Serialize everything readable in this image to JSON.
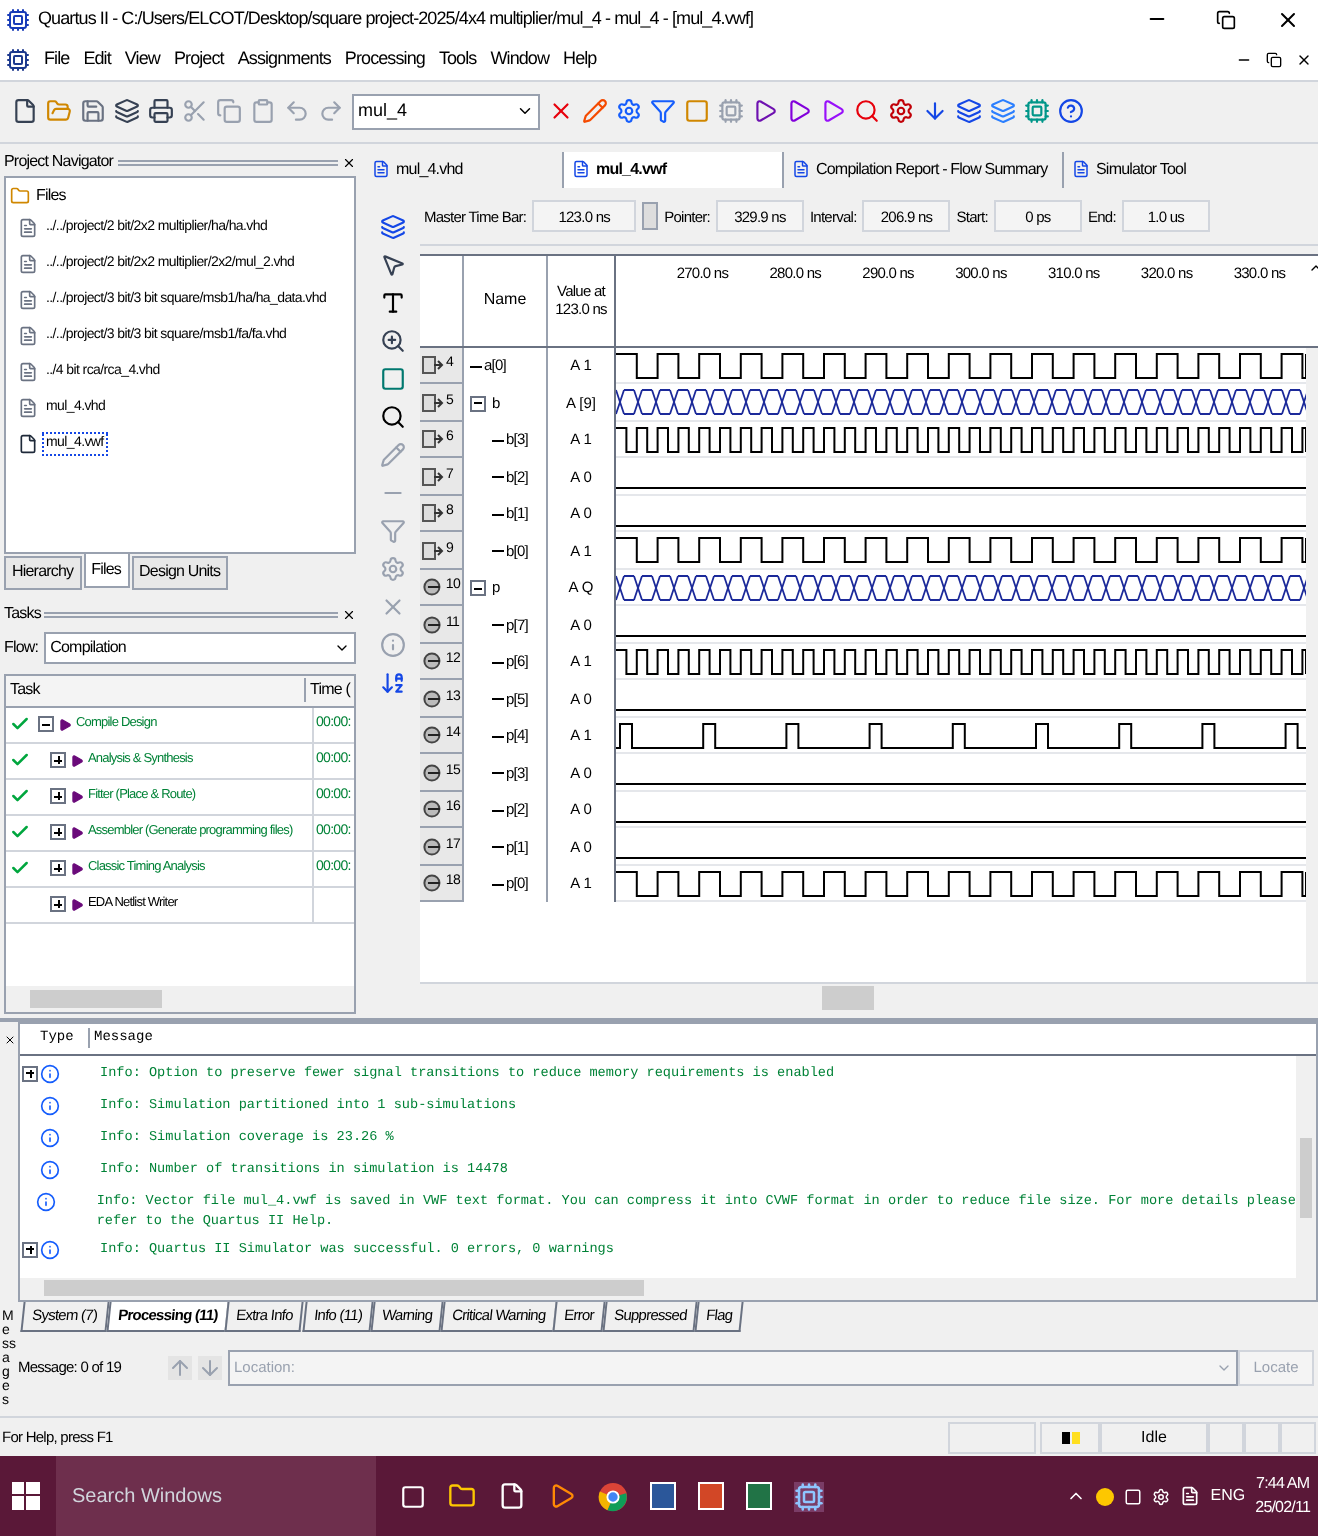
{
  "window": {
    "title": "Quartus II - C:/Users/ELCOT/Desktop/square project-2025/4x4 multiplier/mul_4 - mul_4 - [mul_4.vwf]"
  },
  "menu": [
    "File",
    "Edit",
    "View",
    "Project",
    "Assignments",
    "Processing",
    "Tools",
    "Window",
    "Help"
  ],
  "toolbar": {
    "project": "mul_4"
  },
  "project_navigator": {
    "title": "Project Navigator",
    "root": "Files",
    "files": [
      {
        "name": "../../project/2 bit/2x2 multiplier/ha/ha.vhd",
        "kind": "vhd",
        "selected": false
      },
      {
        "name": "../../project/2 bit/2x2 multiplier/2x2/mul_2.vhd",
        "kind": "vhd",
        "selected": false
      },
      {
        "name": "../../project/3 bit/3 bit square/msb1/ha/ha_data.vhd",
        "kind": "vhd",
        "selected": false
      },
      {
        "name": "../../project/3 bit/3 bit square/msb1/fa/fa.vhd",
        "kind": "vhd",
        "selected": false
      },
      {
        "name": "../4 bit rca/rca_4.vhd",
        "kind": "vhd",
        "selected": false
      },
      {
        "name": "mul_4.vhd",
        "kind": "vhd",
        "selected": false
      },
      {
        "name": "mul_4.vwf",
        "kind": "vwf",
        "selected": true
      }
    ],
    "tabs": [
      {
        "label": "Hierarchy",
        "selected": false
      },
      {
        "label": "Files",
        "selected": true
      },
      {
        "label": "Design Units",
        "selected": false
      }
    ]
  },
  "tasks": {
    "title": "Tasks",
    "flow_label": "Flow:",
    "flow_value": "Compilation",
    "columns": [
      "Task",
      "Time ("
    ],
    "rows": [
      {
        "name": "Compile Design",
        "time": "00:00:",
        "done": true,
        "expanded": true,
        "children": [
          {
            "name": "Analysis & Synthesis",
            "time": "00:00:",
            "done": true,
            "expanded": false
          },
          {
            "name": "Fitter (Place & Route)",
            "time": "00:00:",
            "done": true,
            "expanded": false
          },
          {
            "name": "Assembler (Generate programming files)",
            "time": "00:00:",
            "done": true,
            "expanded": false
          },
          {
            "name": "Classic Timing Analysis",
            "time": "00:00:",
            "done": true,
            "expanded": false
          },
          {
            "name": "EDA Netlist Writer",
            "done": false,
            "expanded": false
          }
        ]
      }
    ]
  },
  "doc_tabs": [
    {
      "label": "mul_4.vhd",
      "selected": false
    },
    {
      "label": "mul_4.vwf",
      "selected": true
    },
    {
      "label": "Compilation Report - Flow Summary",
      "selected": false
    },
    {
      "label": "Simulator Tool",
      "selected": false
    }
  ],
  "time_bar": [
    {
      "label": "Master Time Bar:",
      "value": "123.0 ns"
    },
    {
      "label": "Pointer:",
      "value": "329.9 ns"
    },
    {
      "label": "Interval:",
      "value": "206.9 ns"
    },
    {
      "label": "Start:",
      "value": "0 ps"
    },
    {
      "label": "End:",
      "value": "1.0 us"
    }
  ],
  "columns": {
    "name": "Name",
    "value": "Value at 123.0 ns"
  },
  "ruler": [
    "270.0 ns",
    "280.0 ns",
    "290.0 ns",
    "300.0 ns",
    "310.0 ns",
    "320.0 ns",
    "330.0 ns"
  ],
  "signals": [
    {
      "index": "4",
      "name": "a[0]",
      "value": "A 1",
      "kind": "input",
      "waveform": {
        "kind": "slow"
      }
    },
    {
      "index": "5",
      "name": "b",
      "value": "A [9]",
      "kind": "input",
      "waveform": {
        "kind": "bus"
      },
      "expanded": true,
      "children": [
        {
          "index": "6",
          "name": "b[3]",
          "value": "A 1",
          "kind": "input",
          "waveform": {
            "kind": "fast"
          }
        },
        {
          "index": "7",
          "name": "b[2]",
          "value": "A 0",
          "kind": "input",
          "waveform": {
            "kind": "low"
          }
        },
        {
          "index": "8",
          "name": "b[1]",
          "value": "A 0",
          "kind": "input",
          "waveform": {
            "kind": "low"
          }
        },
        {
          "index": "9",
          "name": "b[0]",
          "value": "A 1",
          "kind": "input",
          "waveform": {
            "kind": "slow"
          }
        }
      ]
    },
    {
      "index": "10",
      "name": "p",
      "value": "A Q",
      "kind": "output",
      "waveform": {
        "kind": "bus"
      },
      "expanded": true,
      "children": [
        {
          "index": "11",
          "name": "p[7]",
          "value": "A 0",
          "kind": "output",
          "waveform": {
            "kind": "low"
          }
        },
        {
          "index": "12",
          "name": "p[6]",
          "value": "A 1",
          "kind": "output",
          "waveform": {
            "kind": "fast"
          }
        },
        {
          "index": "13",
          "name": "p[5]",
          "value": "A 0",
          "kind": "output",
          "waveform": {
            "kind": "low"
          }
        },
        {
          "index": "14",
          "name": "p[4]",
          "value": "A 1",
          "kind": "output",
          "waveform": {
            "kind": "pulse"
          }
        },
        {
          "index": "15",
          "name": "p[3]",
          "value": "A 0",
          "kind": "output",
          "waveform": {
            "kind": "low"
          }
        },
        {
          "index": "16",
          "name": "p[2]",
          "value": "A 0",
          "kind": "output",
          "waveform": {
            "kind": "low"
          }
        },
        {
          "index": "17",
          "name": "p[1]",
          "value": "A 0",
          "kind": "output",
          "waveform": {
            "kind": "low"
          }
        },
        {
          "index": "18",
          "name": "p[0]",
          "value": "A 1",
          "kind": "output",
          "waveform": {
            "kind": "slow"
          }
        }
      ]
    }
  ],
  "messages": {
    "side_label": "Messages",
    "columns": [
      "Type",
      "Message"
    ],
    "rows": [
      {
        "text": "Info: Option to preserve fewer signal transitions to reduce memory requirements is enabled",
        "expandable": true
      },
      {
        "text": "Info: Simulation partitioned into 1 sub-simulations",
        "expandable": false
      },
      {
        "text": "Info: Simulation coverage is      23.26 %",
        "expandable": false
      },
      {
        "text": "Info: Number of transitions in simulation is 14478",
        "expandable": false
      },
      {
        "text": "Info: Vector file mul_4.vwf is saved in VWF text format. You can compress it into CVWF format in order to reduce file size. For more details please refer to the Quartus II Help.",
        "expandable": false
      },
      {
        "text": "Info: Quartus II Simulator was successful. 0 errors, 0 warnings",
        "expandable": true
      }
    ],
    "tabs": [
      {
        "label": "System (7)",
        "selected": false
      },
      {
        "label": "Processing (11)",
        "selected": true
      },
      {
        "label": "Extra Info",
        "selected": false
      },
      {
        "label": "Info (11)",
        "selected": false
      },
      {
        "label": "Warning",
        "selected": false
      },
      {
        "label": "Critical Warning",
        "selected": false
      },
      {
        "label": "Error",
        "selected": false
      },
      {
        "label": "Suppressed",
        "selected": false
      },
      {
        "label": "Flag",
        "selected": false
      }
    ],
    "count": "Message: 0 of 19",
    "location_placeholder": "Location:",
    "locate": "Locate"
  },
  "status_bar": {
    "help": "For Help, press F1",
    "state": "Idle"
  },
  "taskbar": {
    "search_placeholder": "Search Windows",
    "language": "ENG",
    "time": "7:44 AM",
    "date": "25/02/11"
  }
}
